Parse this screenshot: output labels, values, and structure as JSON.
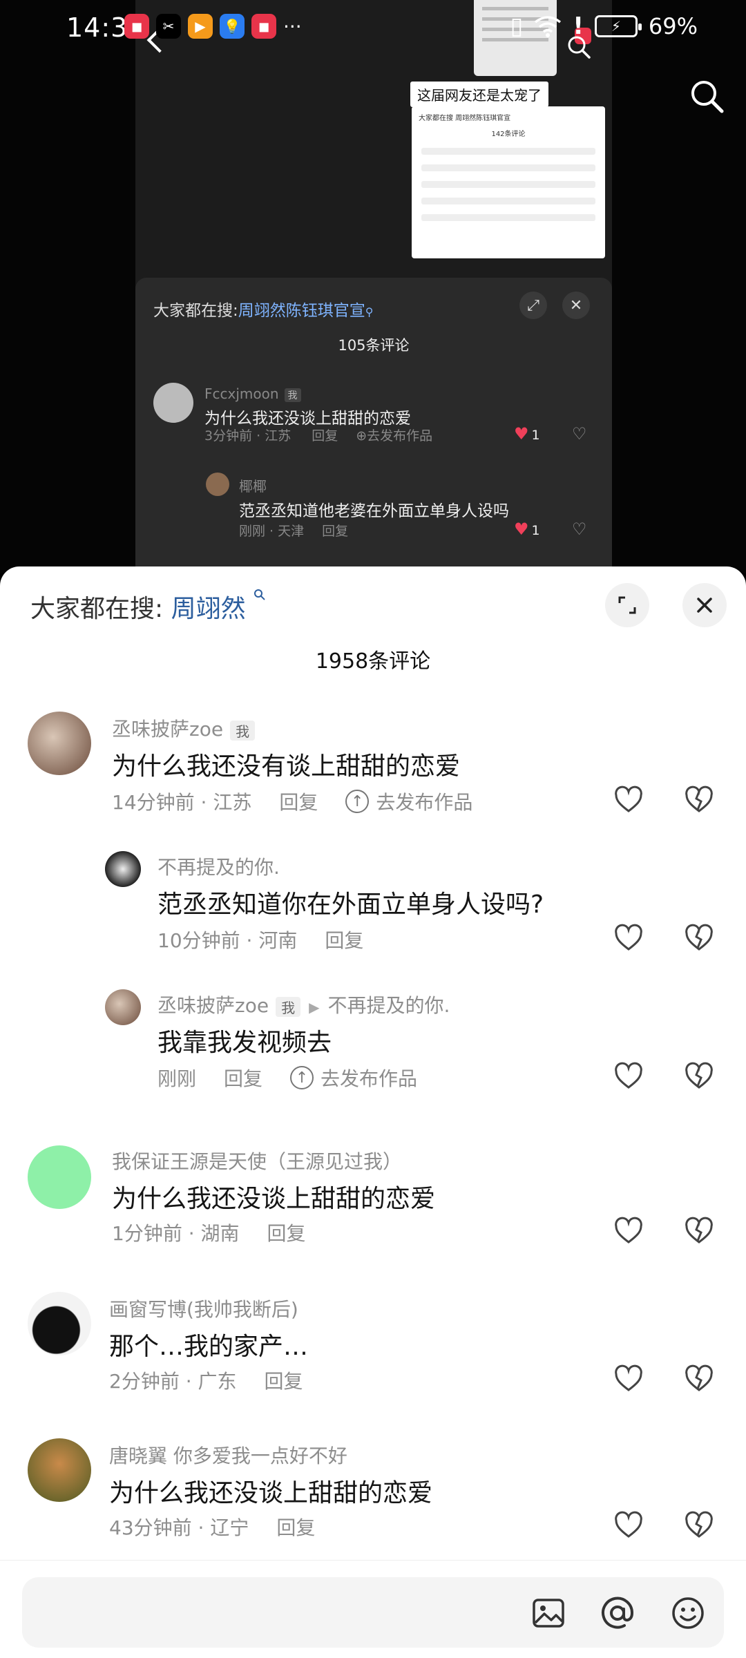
{
  "status_bar": {
    "time": "14:37",
    "battery": "69%"
  },
  "video": {
    "caption": "这届网友还是太宠了",
    "mini_title": "大家都在搜 周翊然陈钰琪官宣",
    "mini_count": "142条评论"
  },
  "overlay": {
    "search_prefix": "大家都在搜:",
    "search_keyword": "周翊然陈钰琪官宣",
    "count": "105条评论",
    "comments": [
      {
        "user": "Fccxjmoon",
        "tag": "我",
        "text": "为什么我还没谈上甜甜的恋爱",
        "time_loc": "3分钟前 · 江苏",
        "reply": "回复",
        "publish": "去发布作品",
        "likes": "1"
      },
      {
        "user": "椰椰",
        "text": "范丞丞知道他老婆在外面立单身人设吗",
        "time_loc": "刚刚 · 天津",
        "reply": "回复",
        "likes": "1"
      }
    ]
  },
  "sheet": {
    "search_prefix": "大家都在搜:",
    "search_keyword": "周翊然",
    "count": "1958条评论",
    "comments": [
      {
        "user": "丞味披萨zoe",
        "tag": "我",
        "text": "为什么我还没有谈上甜甜的恋爱",
        "time_loc": "14分钟前 · 江苏",
        "reply": "回复",
        "publish": "去发布作品"
      },
      {
        "user": "不再提及的你.",
        "text": "范丞丞知道你在外面立单身人设吗?",
        "time_loc": "10分钟前 · 河南",
        "reply": "回复"
      },
      {
        "user": "丞味披萨zoe",
        "tag": "我",
        "reply_to": "不再提及的你.",
        "text": "我靠我发视频去",
        "time_loc": "刚刚",
        "reply": "回复",
        "publish": "去发布作品"
      },
      {
        "user": "我保证王源是天使（王源见过我）",
        "text": "为什么我还没谈上甜甜的恋爱",
        "time_loc": "1分钟前 · 湖南",
        "reply": "回复"
      },
      {
        "user": "画窗写博(我帅我断后)",
        "text": "那个…我的家产…",
        "time_loc": "2分钟前 · 广东",
        "reply": "回复"
      },
      {
        "user": "唐晓翼 你多爱我一点好不好",
        "text": "为什么我还没谈上甜甜的恋爱",
        "time_loc": "43分钟前 · 辽宁",
        "reply": "回复"
      }
    ]
  },
  "input": {
    "placeholder": "",
    "icons": [
      "image-icon",
      "at-icon",
      "emoji-icon"
    ]
  },
  "colors": {
    "keyword_dark": "#2c5e9e",
    "keyword_overlay": "#7fb4ff",
    "heart_red": "#f0405a",
    "mint_avatar": "#8ef0a8"
  }
}
